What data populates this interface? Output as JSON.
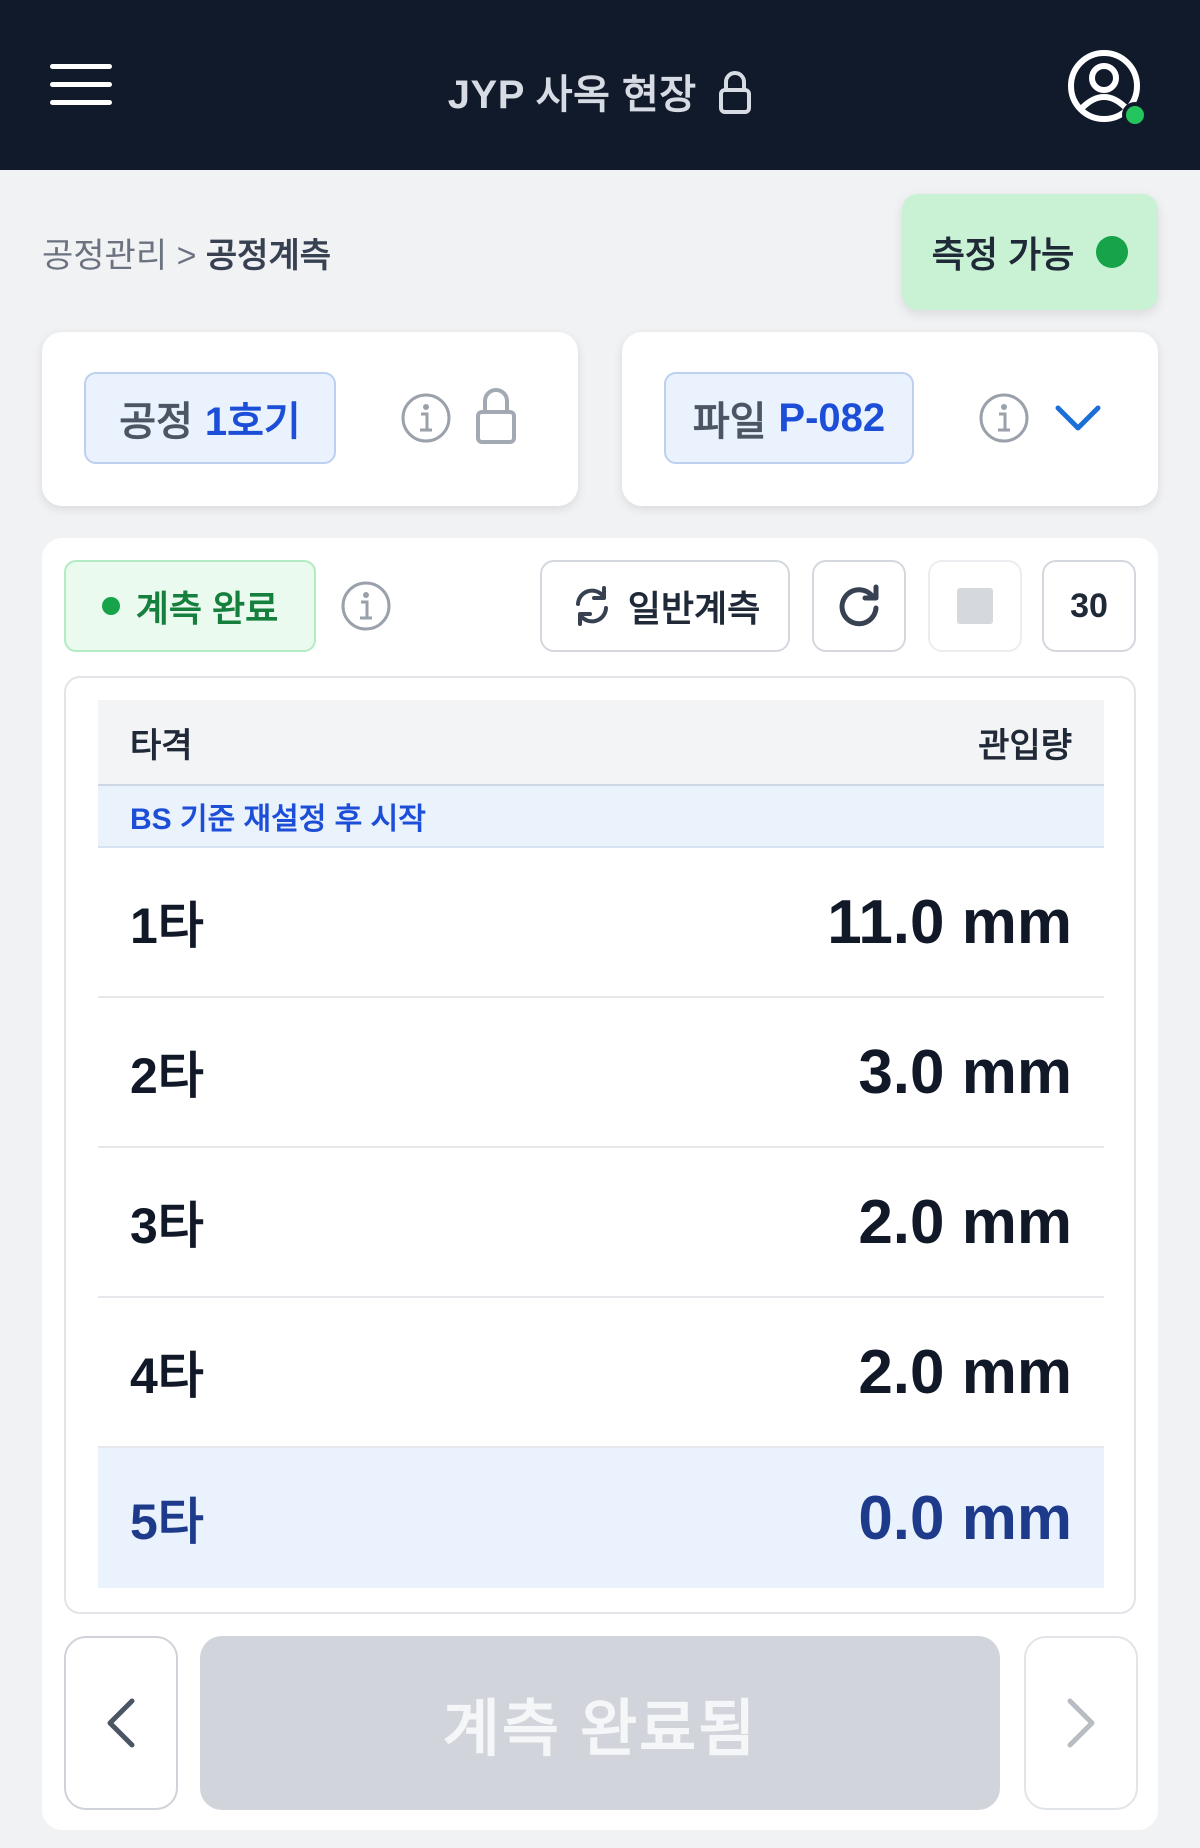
{
  "header": {
    "title": "JYP 사옥 현장",
    "icons": {
      "menu": "hamburger-icon",
      "lock": "lock-icon",
      "profile": "user-circle-icon"
    },
    "online_color": "#22c55e"
  },
  "breadcrumb": {
    "parent": "공정관리",
    "separator": ">",
    "current": "공정계측"
  },
  "status": {
    "label": "측정 가능",
    "color": "#16a34a"
  },
  "process_selector": {
    "prefix": "공정",
    "value": "1호기"
  },
  "pile_selector": {
    "prefix": "파일",
    "value": "P-082"
  },
  "toolbar": {
    "state_label": "계측 완료",
    "mode_label": "일반계측",
    "count": "30"
  },
  "table": {
    "col_blow": "타격",
    "col_penetration": "관입량",
    "note": "BS 기준 재설정 후 시작",
    "rows": [
      {
        "label": "1타",
        "value": "11.0 mm"
      },
      {
        "label": "2타",
        "value": "3.0 mm"
      },
      {
        "label": "3타",
        "value": "2.0 mm"
      },
      {
        "label": "4타",
        "value": "2.0 mm"
      },
      {
        "label": "5타",
        "value": "0.0 mm",
        "active": true
      }
    ]
  },
  "footer": {
    "complete_label": "계측 완료됨"
  }
}
